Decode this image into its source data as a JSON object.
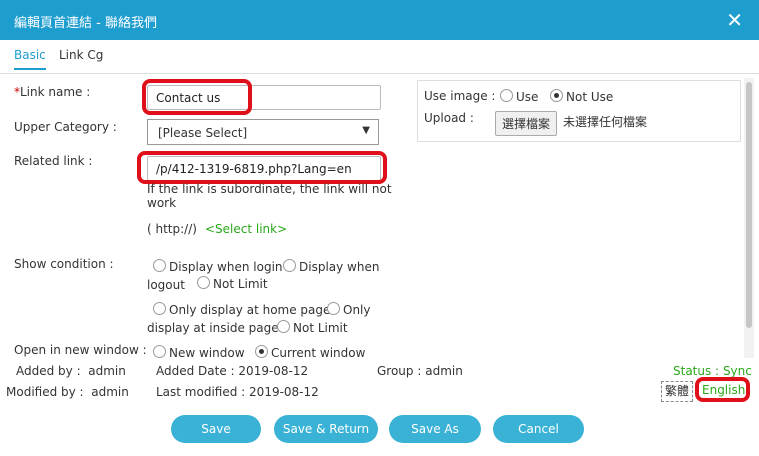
{
  "window": {
    "title": "編輯頁首連結 - 聯絡我們",
    "close_glyph": "✕"
  },
  "tabs": [
    {
      "label": "Basic",
      "active": true
    },
    {
      "label": "Link Cg",
      "active": false
    }
  ],
  "form": {
    "link_name": {
      "label": "Link name :",
      "required_mark": "*",
      "value": "Contact us"
    },
    "upper_category": {
      "label": "Upper Category :",
      "value": "[Please Select]"
    },
    "related_link": {
      "label": "Related link :",
      "value": "/p/412-1319-6819.php?Lang=en",
      "hint_line1": "If the link is subordinate, the link will not",
      "hint_line2": "work",
      "http_prefix": "( http://)",
      "select_link": "<Select link>"
    },
    "show_condition": {
      "label": "Show condition :",
      "opt1a": "Display when login",
      "opt1b": "Display when",
      "opt1c": "logout",
      "opt2": "Not Limit",
      "opt3a": "Only display at home page",
      "opt3b": "Only",
      "opt3c": "display at inside page",
      "opt4": "Not Limit"
    },
    "open_new_window": {
      "label": "Open in new window :",
      "opt_new": "New window",
      "opt_current": "Current window",
      "selected": "Current window"
    },
    "use_image": {
      "label": "Use image :",
      "opt_use": "Use",
      "opt_not_use": "Not Use",
      "selected": "Not Use"
    },
    "upload": {
      "label": "Upload :",
      "button": "選擇檔案",
      "status": "未選擇任何檔案"
    }
  },
  "meta": {
    "added_by_label": "Added by :",
    "added_by": "admin",
    "added_date_label": "Added Date :",
    "added_date": "2019-08-12",
    "group_label": "Group :",
    "group": "admin",
    "status_label": "Status :",
    "status": "Sync",
    "modified_by_label": "Modified by :",
    "modified_by": "admin",
    "last_modified_label": "Last modified :",
    "last_modified": "2019-08-12",
    "lang_trad": "繁體",
    "lang_en": "English"
  },
  "buttons": {
    "save": "Save",
    "save_return": "Save & Return",
    "save_as": "Save As",
    "cancel": "Cancel"
  },
  "colors": {
    "titlebar": "#1e9dcf",
    "button": "#3ab2d6",
    "highlight": "#e0101a",
    "green": "#2aa81a"
  }
}
